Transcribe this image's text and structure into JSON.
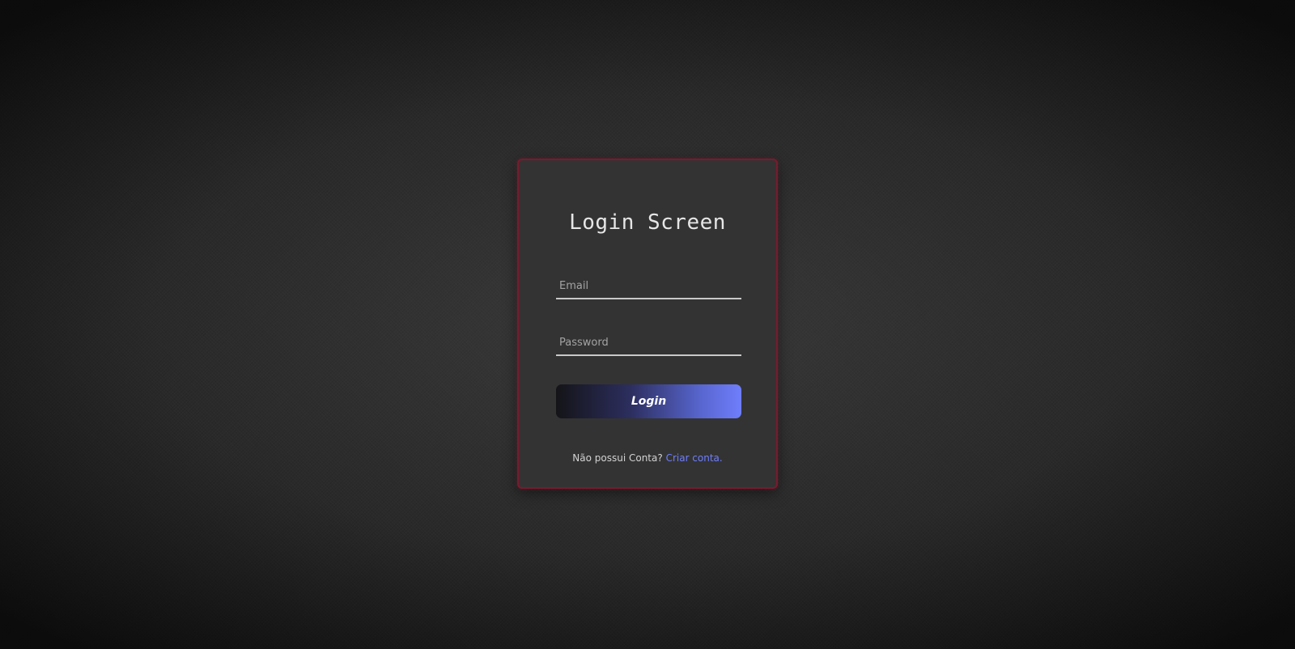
{
  "login_card": {
    "title": "Login Screen",
    "email_placeholder": "Email",
    "email_value": "",
    "password_placeholder": "Password",
    "password_value": "",
    "login_button_label": "Login",
    "signup_prompt": "Não possui Conta?",
    "signup_link_label": "Criar conta."
  },
  "colors": {
    "card_border": "#7a1a2e",
    "card_background": "#333333",
    "button_gradient_start": "#141418",
    "button_gradient_end": "#6f7efc",
    "link": "#6f7efc"
  }
}
